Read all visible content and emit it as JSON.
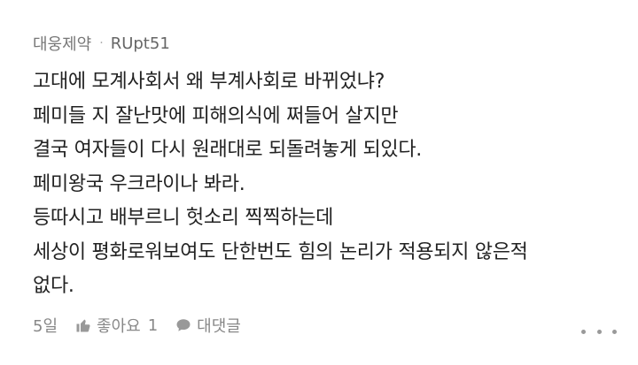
{
  "comment": {
    "source": "대웅제약",
    "separator": "·",
    "author": "RUpt51",
    "lines": [
      "고대에 모계사회서 왜 부계사회로 바뀌었냐?",
      "페미들 지 잘난맛에 피해의식에 쩌들어 살지만",
      "결국 여자들이 다시 원래대로 되돌려놓게 되있다.",
      "페미왕국 우크라이나 봐라.",
      "등따시고 배부르니 헛소리 찍찍하는데",
      "세상이 평화로워보여도 단한번도 힘의 논리가 적용되지 않은적",
      "없다."
    ],
    "time": "5일",
    "like_label": "좋아요",
    "like_count": "1",
    "reply_label": "대댓글",
    "icons": {
      "like": "thumbs-up-icon",
      "reply": "speech-bubble-icon",
      "more": "more-dots-icon"
    },
    "colors": {
      "text": "#222222",
      "meta": "#777777",
      "icon": "#999999"
    }
  }
}
